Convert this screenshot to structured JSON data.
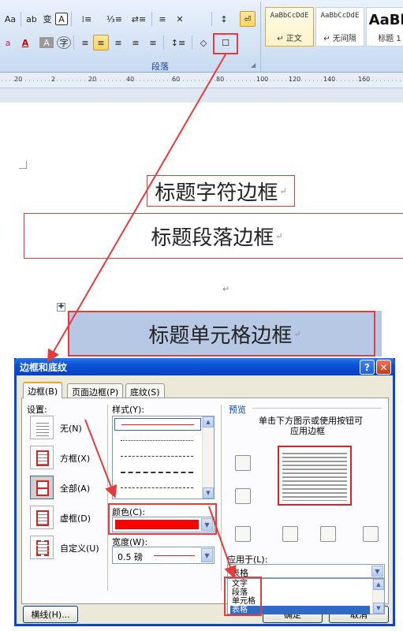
{
  "ribbon": {
    "row1": [
      "Aa",
      "ab",
      "变",
      "A",
      "⁞≡",
      "⅓≡",
      "⇄≡",
      "≡",
      "✕",
      "↕",
      "⏎"
    ],
    "row2": [
      "a",
      "A",
      "A",
      "字",
      "≡",
      "≡",
      "≡",
      "≡",
      "≡",
      "↕≡",
      "◇",
      "☐"
    ],
    "group_label": "段落",
    "styles": [
      {
        "sample": "AaBbCcDdE",
        "name": "↵ 正文"
      },
      {
        "sample": "AaBbCcDdE",
        "name": "↵ 无间隔"
      },
      {
        "sample": "AaBb",
        "name": "标题 1"
      }
    ],
    "colors": {
      "accent": "#e53b3b",
      "ribbon": "#d6e4f5"
    }
  },
  "ruler": {
    "labels": [
      "20",
      "2",
      "20",
      "40",
      "60",
      "80",
      "100",
      "120",
      "140",
      "160",
      "20",
      "20"
    ]
  },
  "document": {
    "heading_char_border": "标题字符边框",
    "heading_para_border": "标题段落边框",
    "heading_cell_border": "标题单元格边框",
    "para_mark": "↵",
    "table_handle": "✚"
  },
  "dialog": {
    "title": "边框和底纹",
    "help": "?",
    "close": "✕",
    "tabs": [
      "边框(B)",
      "页面边框(P)",
      "底纹(S)"
    ],
    "settings_label": "设置:",
    "settings": [
      "无(N)",
      "方框(X)",
      "全部(A)",
      "虚框(D)",
      "自定义(U)"
    ],
    "style_label": "样式(Y):",
    "color_label": "颜色(C):",
    "width_label": "宽度(W):",
    "width_value": "0.5 磅",
    "preview_label": "预览",
    "preview_hint_line1": "单击下方图示或使用按钮可",
    "preview_hint_line2": "应用边框",
    "apply_label": "应用于(L):",
    "apply_value": "表格",
    "apply_options": [
      "文字",
      "段落",
      "单元格",
      "表格"
    ],
    "hline_button": "横线(H)...",
    "ok_button": "确定",
    "cancel_button": "取消",
    "selected_color": "#ff0000"
  }
}
